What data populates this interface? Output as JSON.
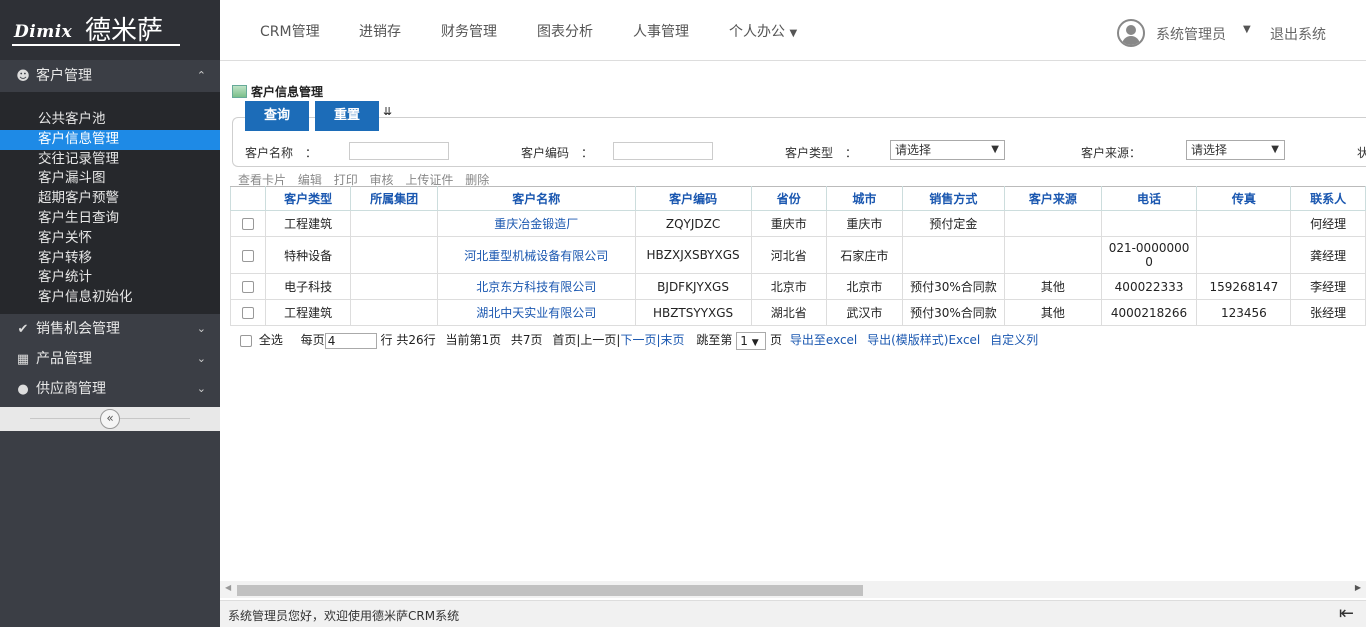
{
  "logo": {
    "brand_en": "Dimix",
    "brand_cn": "德米萨"
  },
  "nav": {
    "items": [
      "CRM管理",
      "进销存",
      "财务管理",
      "图表分析",
      "人事管理",
      "个人办公"
    ],
    "user": "系统管理员",
    "logout": "退出系统"
  },
  "sidebar": {
    "customer_menu": "客户管理",
    "sub_items": [
      "公共客户池",
      "客户信息管理",
      "交往记录管理",
      "客户漏斗图",
      "超期客户预警",
      "客户生日查询",
      "客户关怀",
      "客户转移",
      "客户统计",
      "客户信息初始化"
    ],
    "sales_menu": "销售机会管理",
    "product_menu": "产品管理",
    "supplier_menu": "供应商管理"
  },
  "page": {
    "title": "客户信息管理",
    "query_btn": "查询",
    "reset_btn": "重置"
  },
  "filters": {
    "name_label": "客户名称　：",
    "code_label": "客户编码　：",
    "type_label": "客户类型　：",
    "source_label": "客户来源：",
    "type_value": "请选择",
    "source_value": "请选择",
    "extra_label": "状"
  },
  "toolbar": [
    "查看卡片",
    "编辑",
    "打印",
    "审核",
    "上传证件",
    "删除"
  ],
  "table": {
    "headers": [
      "客户类型",
      "所属集团",
      "客户名称",
      "客户编码",
      "省份",
      "城市",
      "销售方式",
      "客户来源",
      "电话",
      "传真",
      "联系人"
    ],
    "rows": [
      {
        "type": "工程建筑",
        "group": "",
        "name": "重庆冶金锻造厂",
        "code": "ZQYJDZC",
        "province": "重庆市",
        "city": "重庆市",
        "sales": "预付定金",
        "source": "",
        "phone": "",
        "fax": "",
        "contact": "何经理"
      },
      {
        "type": "特种设备",
        "group": "",
        "name": "河北重型机械设备有限公司",
        "code": "HBZXJXSBYXGS",
        "province": "河北省",
        "city": "石家庄市",
        "sales": "",
        "source": "",
        "phone": "021-00000000",
        "fax": "",
        "contact": "龚经理"
      },
      {
        "type": "电子科技",
        "group": "",
        "name": "北京东方科技有限公司",
        "code": "BJDFKJYXGS",
        "province": "北京市",
        "city": "北京市",
        "sales": "预付30%合同款",
        "source": "其他",
        "phone": "400022333",
        "fax": "159268147",
        "contact": "李经理"
      },
      {
        "type": "工程建筑",
        "group": "",
        "name": "湖北中天实业有限公司",
        "code": "HBZTSYYXGS",
        "province": "湖北省",
        "city": "武汉市",
        "sales": "预付30%合同款",
        "source": "其他",
        "phone": "4000218266",
        "fax": "123456",
        "contact": "张经理"
      }
    ]
  },
  "pager": {
    "select_all": "全选",
    "per_page_label": "每页",
    "per_page_value": "4",
    "rows_text": "行 共26行",
    "current_text": "当前第1页",
    "total_pages": "共7页",
    "first_prev": "首页|上一页|",
    "next": "下一页",
    "sep": "|",
    "last": "末页",
    "jump_label": "跳至第",
    "jump_value": "1",
    "page_suffix": "页",
    "export_excel": "导出至excel",
    "export_template": "导出(模版样式)Excel",
    "custom_cols": "自定义列"
  },
  "status": {
    "message": "系统管理员您好，欢迎使用德米萨CRM系统"
  }
}
